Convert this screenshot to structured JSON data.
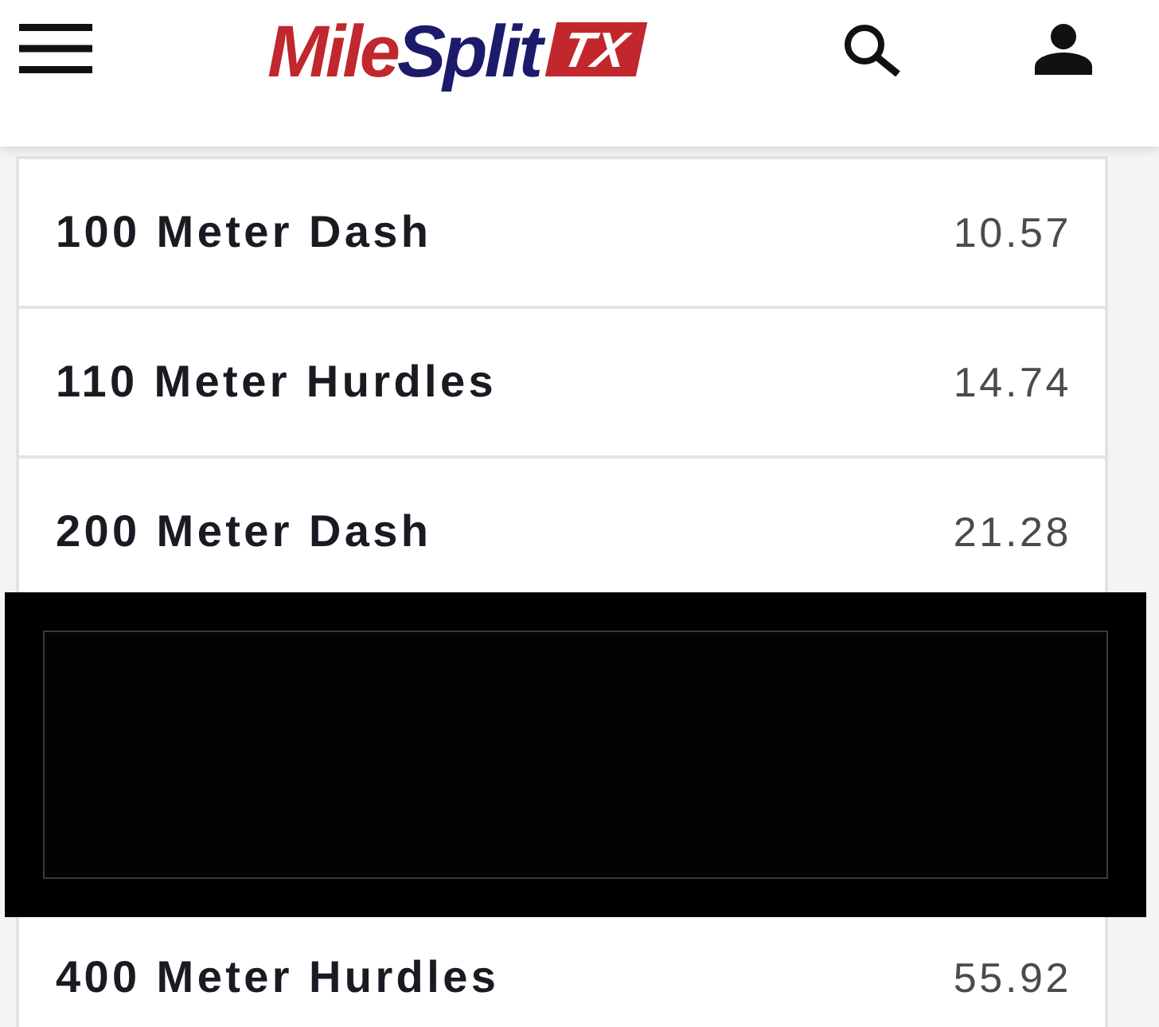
{
  "header": {
    "logo": {
      "name": [
        "Mile",
        "Split"
      ],
      "badge": "TX"
    }
  },
  "results": [
    {
      "kind": "event",
      "event": "100 Meter Dash",
      "mark": "10.57"
    },
    {
      "kind": "event",
      "event": "110 Meter Hurdles",
      "mark": "14.74"
    },
    {
      "kind": "event",
      "event": "200 Meter Dash",
      "mark": "21.28"
    },
    {
      "kind": "redacted"
    },
    {
      "kind": "event",
      "event": "400 Meter Hurdles",
      "mark": "55.92"
    }
  ]
}
